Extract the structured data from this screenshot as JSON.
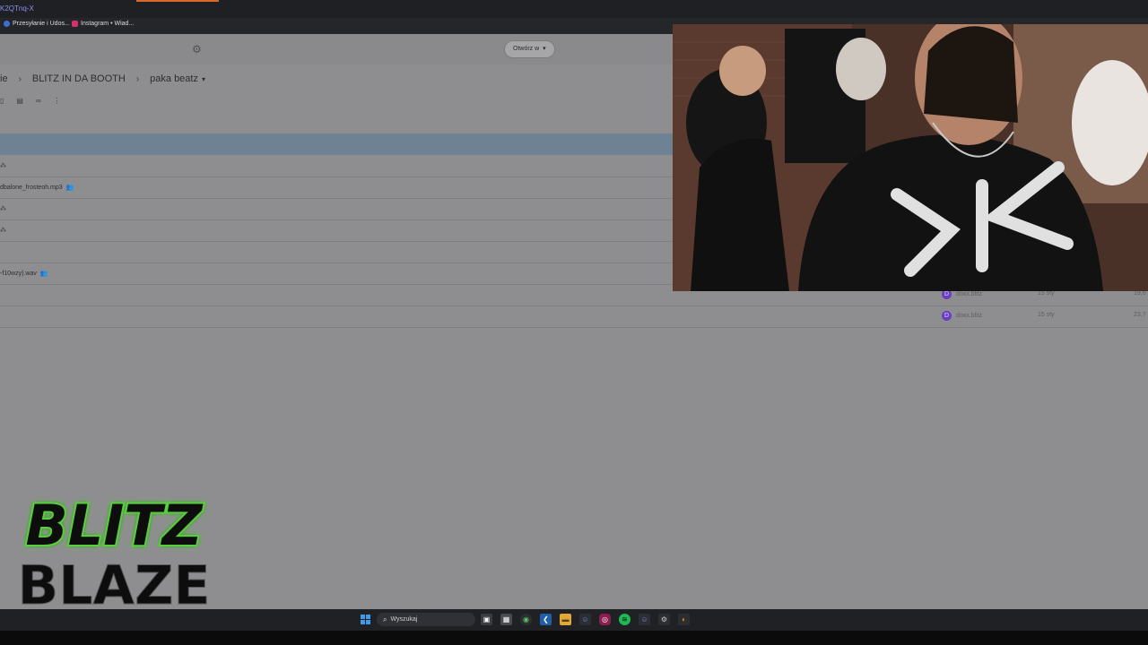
{
  "browser": {
    "url_fragment": "K2QTnq-X",
    "bookmarks": [
      {
        "label": "Przesyłanie i Udos...",
        "icon": "facebook-icon",
        "color": "#3b6fd8"
      },
      {
        "label": "Instagram • Wiad...",
        "icon": "instagram-icon",
        "color": "#d6306e"
      }
    ]
  },
  "toolbar": {
    "open_button_label": "Otwórz w"
  },
  "breadcrumb": {
    "items": [
      "ie",
      "BLITZ IN DA BOOTH",
      "paka beatz"
    ]
  },
  "files": [
    {
      "name": "",
      "owner": "",
      "modified": "",
      "size": "",
      "selected": true
    },
    {
      "name": "",
      "owner": "",
      "modified": "",
      "size": ""
    },
    {
      "name": "dbalone_frosteoh.mp3",
      "owner": "",
      "modified": "",
      "size": ""
    },
    {
      "name": "",
      "owner": "",
      "modified": "",
      "size": ""
    },
    {
      "name": "",
      "owner": "",
      "modified": "",
      "size": ""
    },
    {
      "name": "",
      "owner": "",
      "modified": "",
      "size": ""
    },
    {
      "name": "-f10wzy).wav",
      "owner": "",
      "modified": "",
      "size": ""
    },
    {
      "name": "",
      "owner": "doxx.blitz",
      "owner_initial": "D",
      "modified": "15 sty",
      "size": "19,6"
    },
    {
      "name": "",
      "owner": "doxx.blitz",
      "owner_initial": "D",
      "modified": "15 sty",
      "size": "23,7"
    }
  ],
  "logo": {
    "line1": "BLITZ",
    "line2": "BLAZE"
  },
  "taskbar": {
    "search_placeholder": "Wyszukaj",
    "apps": [
      {
        "icon": "task-view-icon",
        "color": "#c9c9c9"
      },
      {
        "icon": "widgets-icon",
        "color": "#e3e3e3"
      },
      {
        "icon": "chrome-icon",
        "color": "#4caf50"
      },
      {
        "icon": "vscode-icon",
        "color": "#2e7ad1"
      },
      {
        "icon": "file-explorer-icon",
        "color": "#f2c14e"
      },
      {
        "icon": "discord-icon",
        "color": "#5865f2"
      },
      {
        "icon": "instagram-icon",
        "color": "#c13584"
      },
      {
        "icon": "spotify-icon",
        "color": "#1db954"
      },
      {
        "icon": "discord-ptb-icon",
        "color": "#5865f2"
      },
      {
        "icon": "steam-icon",
        "color": "#9aa0a6"
      },
      {
        "icon": "firefox-icon",
        "color": "#e66000"
      }
    ]
  }
}
